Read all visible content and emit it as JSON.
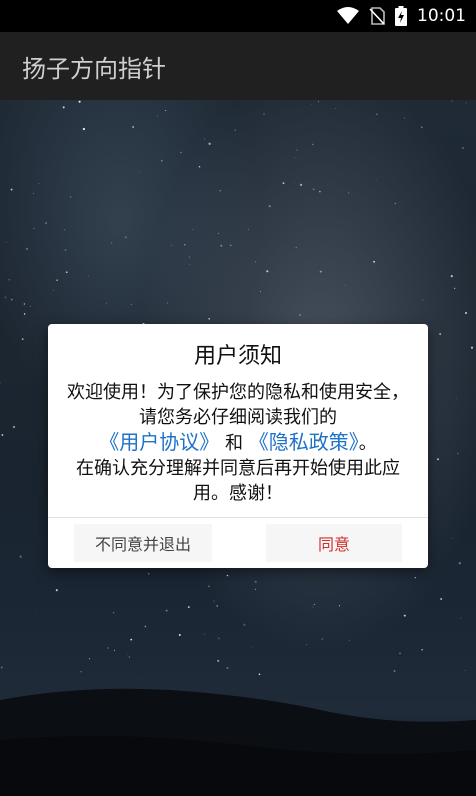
{
  "status_bar": {
    "time": "10:01",
    "icons": [
      "wifi-icon",
      "no-sim-icon",
      "battery-charging-icon"
    ]
  },
  "app_bar": {
    "title": "扬子方向指针"
  },
  "dialog": {
    "title": "用户须知",
    "body_text_1": "欢迎使用！为了保护您的隐私和使用安全，请您务必仔细阅读我们的",
    "link_user_agreement": "《用户协议》",
    "body_and": "和",
    "link_privacy_policy": "《隐私政策》",
    "body_period": "。",
    "body_text_2": "在确认充分理解并同意后再开始使用此应用。感谢！",
    "decline_label": "不同意并退出",
    "agree_label": "同意"
  },
  "colors": {
    "link": "#1e72c8",
    "agree": "#d0302f",
    "app_bar": "#202020"
  }
}
